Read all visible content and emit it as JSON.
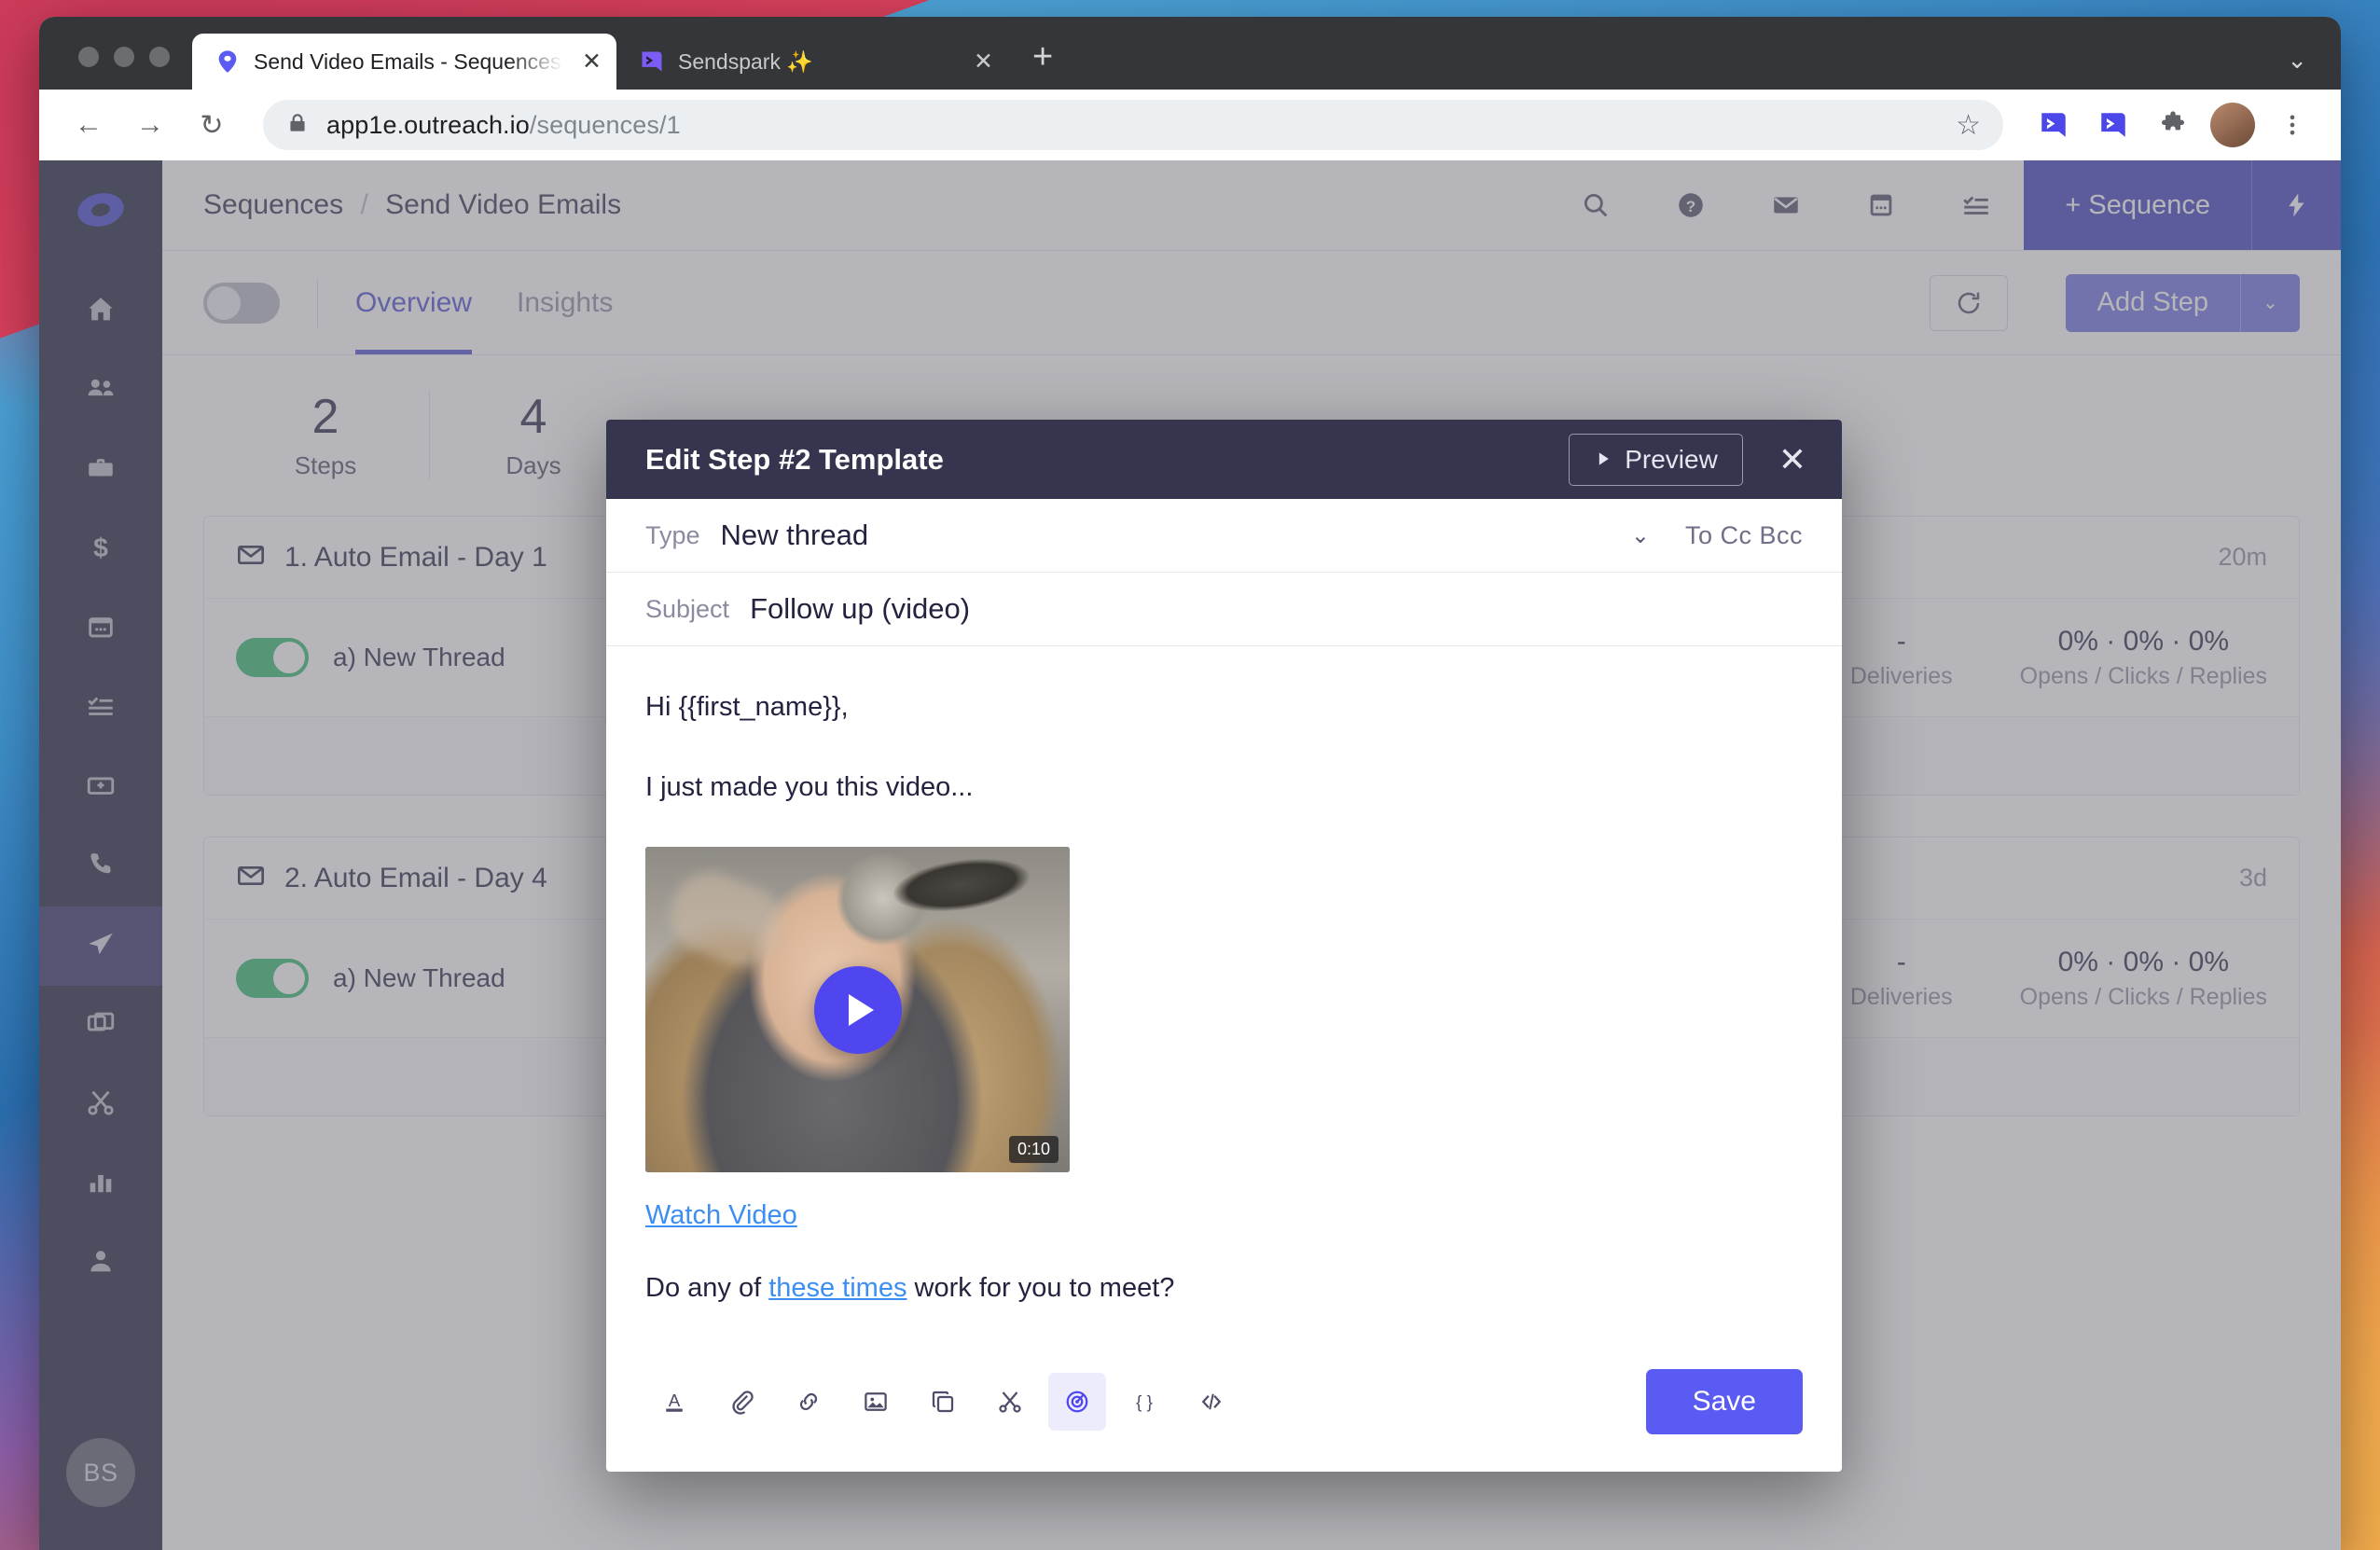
{
  "browser": {
    "tabs": [
      {
        "title": "Send Video Emails - Sequences",
        "favicon": "outreach-logo-icon",
        "active": true,
        "close_label": "✕"
      },
      {
        "title": "Sendspark ✨",
        "favicon": "sendspark-logo-icon",
        "active": false,
        "close_label": "✕"
      }
    ],
    "new_tab_label": "+",
    "window_chevron": "⌄",
    "nav": {
      "back": "←",
      "forward": "→",
      "reload": "↻"
    },
    "omnibox": {
      "lock_icon": "lock-icon",
      "host": "app1e.outreach.io",
      "path": "/sequences/1",
      "star": "☆"
    }
  },
  "sidebar": {
    "logo": "outreach-logo-icon",
    "items": [
      {
        "icon": "home-icon",
        "name": "home",
        "active": false
      },
      {
        "icon": "people-icon",
        "name": "prospects",
        "active": false
      },
      {
        "icon": "briefcase-icon",
        "name": "accounts",
        "active": false
      },
      {
        "icon": "dollar-icon",
        "name": "opportunities",
        "active": false
      },
      {
        "icon": "calendar-icon",
        "name": "calendar",
        "active": false
      },
      {
        "icon": "tasks-icon",
        "name": "tasks",
        "active": false
      },
      {
        "icon": "card-add-icon",
        "name": "templates",
        "active": false
      },
      {
        "icon": "phone-icon",
        "name": "calls",
        "active": false
      },
      {
        "icon": "paper-plane-icon",
        "name": "sequences",
        "active": true
      },
      {
        "icon": "stack-icon",
        "name": "snippets",
        "active": false
      },
      {
        "icon": "scissors-icon",
        "name": "clips",
        "active": false
      },
      {
        "icon": "bar-chart-icon",
        "name": "reports",
        "active": false
      },
      {
        "icon": "person-icon",
        "name": "profile",
        "active": false
      }
    ],
    "avatar_initials": "BS"
  },
  "app_header": {
    "breadcrumb_root": "Sequences",
    "breadcrumb_separator": "/",
    "breadcrumb_current": "Send Video Emails",
    "icons": [
      "search-icon",
      "help-icon",
      "mail-icon",
      "calendar-icon",
      "tasks-icon"
    ],
    "sequence_button": "+ Sequence",
    "bolt_icon": "lightning-bolt-icon"
  },
  "subbar": {
    "toggle_on": false,
    "tabs": [
      {
        "label": "Overview",
        "active": true
      },
      {
        "label": "Insights",
        "active": false
      }
    ],
    "refresh_icon": "refresh-icon",
    "add_step_label": "Add Step",
    "add_step_caret": "⌄"
  },
  "stats": [
    {
      "number": "2",
      "label": "Steps"
    },
    {
      "number": "4",
      "label": "Days"
    }
  ],
  "steps": [
    {
      "icon": "envelope-icon",
      "title": "1. Auto Email - Day 1",
      "when": "20m",
      "enabled": true,
      "variant": "a) New Thread",
      "metrics": [
        {
          "value": "-",
          "key": "Deliveries"
        },
        {
          "value": "0% · 0% · 0%",
          "key": "Opens / Clicks / Replies"
        }
      ]
    },
    {
      "icon": "envelope-icon",
      "title": "2. Auto Email - Day 4",
      "when": "3d",
      "enabled": true,
      "variant": "a) New Thread",
      "metrics": [
        {
          "value": "-",
          "key": "Deliveries"
        },
        {
          "value": "0% · 0% · 0%",
          "key": "Opens / Clicks / Replies"
        }
      ]
    }
  ],
  "modal": {
    "title": "Edit Step #2 Template",
    "preview_label": "Preview",
    "preview_icon": "play-triangle-icon",
    "close_label": "✕",
    "type_label": "Type",
    "type_value": "New thread",
    "type_chevron": "⌄",
    "recipients": "To Cc Bcc",
    "subject_label": "Subject",
    "subject_value": "Follow up (video)",
    "body": {
      "greeting": "Hi {{first_name}},",
      "line2": "I just made you this video...",
      "video": {
        "duration": "0:10",
        "play_icon": "play-icon"
      },
      "watch_link": "Watch Video",
      "closing_prefix": "Do any of ",
      "closing_link": "these times",
      "closing_suffix": " work for you to meet?"
    },
    "toolbar": [
      {
        "icon": "text-color-icon",
        "name": "text-color",
        "active": false
      },
      {
        "icon": "paperclip-icon",
        "name": "attachment",
        "active": false
      },
      {
        "icon": "link-icon",
        "name": "insert-link",
        "active": false
      },
      {
        "icon": "image-icon",
        "name": "insert-image",
        "active": false
      },
      {
        "icon": "copy-icon",
        "name": "insert-template",
        "active": false
      },
      {
        "icon": "scissors-icon",
        "name": "insert-snippet",
        "active": false
      },
      {
        "icon": "sendspark-target-icon",
        "name": "insert-video",
        "active": true
      },
      {
        "icon": "variables-icon",
        "name": "insert-variable",
        "active": false
      },
      {
        "icon": "code-icon",
        "name": "html-source",
        "active": false
      }
    ],
    "save_label": "Save"
  },
  "colors": {
    "accent": "#4747d1",
    "save": "#5a5bf2",
    "modal_header": "#363550",
    "sidebar": "#181a33",
    "toggle_on": "#2fb86b",
    "link": "#3d8ef2"
  }
}
